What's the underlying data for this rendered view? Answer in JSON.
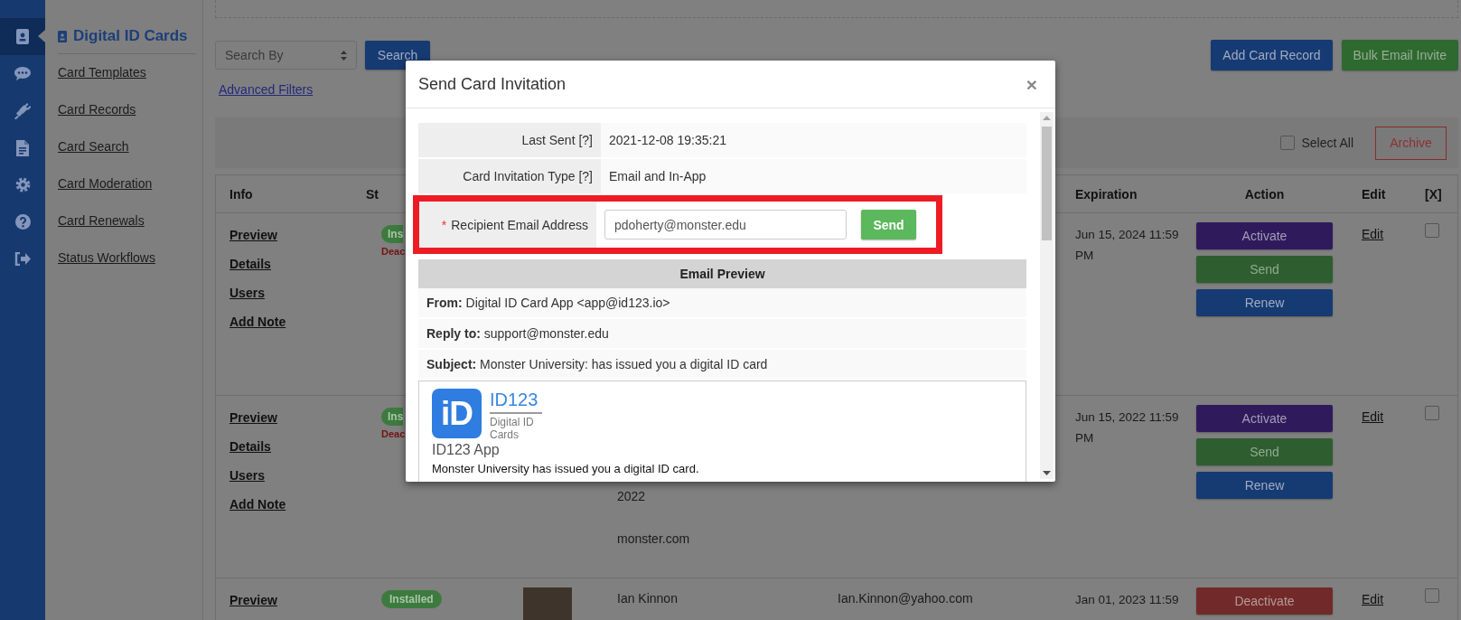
{
  "rail": {
    "items": [
      {
        "selected": true
      },
      {
        "selected": false
      },
      {
        "selected": false
      },
      {
        "selected": false
      },
      {
        "selected": false
      },
      {
        "selected": false
      },
      {
        "selected": false
      }
    ]
  },
  "sidebar": {
    "title": "Digital ID Cards",
    "links": [
      "Card Templates",
      "Card Records",
      "Card Search",
      "Card Moderation",
      "Card Renewals",
      "Status Workflows"
    ]
  },
  "toolbar": {
    "search_select": "Search By",
    "search_button": "Search",
    "advanced_link": "Advanced Filters",
    "buttons": [
      {
        "label": "Add Card Record",
        "kind": "primary"
      },
      {
        "label": "Bulk Email Invite",
        "kind": "success"
      }
    ],
    "select_all": {
      "label": "Select All",
      "checked": false
    },
    "archive": "Archive"
  },
  "table": {
    "columns": [
      "Info",
      "St",
      "Expiration",
      "Action",
      "Edit",
      "[X]"
    ],
    "rows": [
      {
        "kind": "covered",
        "links": [
          "Preview",
          "Details",
          "Users",
          "Add Note"
        ],
        "status": {
          "badge": "Ins",
          "note": "Deac"
        },
        "expiration": "Jun 15, 2024 11:59 PM",
        "actions": [
          {
            "label": "Activate",
            "kind": "activate"
          },
          {
            "label": "Send",
            "kind": "send"
          },
          {
            "label": "Renew",
            "kind": "renew"
          }
        ],
        "edit": "Edit",
        "checked": false
      },
      {
        "kind": "covered",
        "links": [
          "Preview",
          "Details",
          "Users",
          "Add Note"
        ],
        "status": {
          "badge": "Ins",
          "note": "Deac"
        },
        "name_lines": [
          "2022",
          "monster.com"
        ],
        "expiration": "Jun 15, 2022 11:59 PM",
        "actions": [
          {
            "label": "Activate",
            "kind": "activate"
          },
          {
            "label": "Send",
            "kind": "send"
          },
          {
            "label": "Renew",
            "kind": "renew"
          }
        ],
        "edit": "Edit",
        "checked": false
      },
      {
        "kind": "full",
        "links": [
          "Preview"
        ],
        "status": {
          "badge": "Installed"
        },
        "photo": true,
        "name_lines": [
          "Ian Kinnon"
        ],
        "email": "Ian.Kinnon@yahoo.com",
        "expiration": "Jan 01, 2023 11:59",
        "actions": [
          {
            "label": "Deactivate",
            "kind": "deactivate"
          }
        ],
        "edit": "Edit",
        "checked": false
      }
    ]
  },
  "modal": {
    "title": "Send Card Invitation",
    "close": "×",
    "fields": [
      {
        "label": "Last Sent [?]",
        "value": "2021-12-08 19:35:21"
      },
      {
        "label": "Card Invitation Type [?]",
        "value": "Email and In-App"
      }
    ],
    "recipient": {
      "required_mark": "*",
      "label": "Recipient Email Address",
      "value": "pdoherty@monster.edu",
      "button": "Send",
      "highlighted": true
    },
    "preview": {
      "heading": "Email Preview",
      "headers": [
        "**From:** Digital ID Card App <app@id123.io>",
        "**Reply to:** support@monster.edu",
        "**Subject:** Monster University: has issued you a digital ID card"
      ],
      "logo_mark": "iD",
      "brand": "ID123",
      "tagline": "Digital ID Cards",
      "app_name": "ID123 App",
      "body": "Monster University has issued you a digital ID card."
    }
  }
}
